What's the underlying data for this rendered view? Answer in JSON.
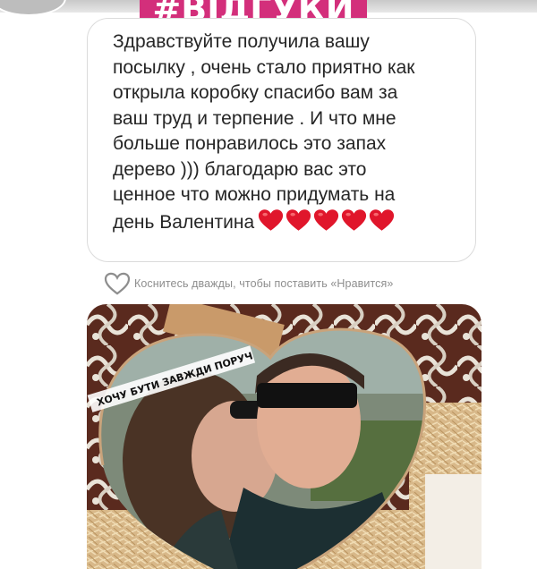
{
  "header": {
    "hashtag": "#ВІДГУКИ"
  },
  "message": {
    "lines": [
      "Здравствуйте получила вашу",
      "посылку , очень стало приятно как",
      "открыла коробку спасибо вам за",
      "ваш труд и терпение . И что мне",
      "больше понравилось это запах",
      "дерево ))) благодарю вас это",
      "ценное что можно придумать на",
      "день Валентина"
    ],
    "emoji": "heart",
    "emoji_count": 5
  },
  "like_hint": {
    "text": "Коснитесь дважды, чтобы поставить «Нравится»"
  },
  "photo": {
    "caption": "ХОЧУ БУТИ ЗАВЖДИ ПОРУЧ"
  },
  "colors": {
    "badge": "#d32f7b",
    "heart": "#e0162b",
    "bubble_border": "#dbdbdb",
    "hint_text": "#8e8e8e"
  }
}
